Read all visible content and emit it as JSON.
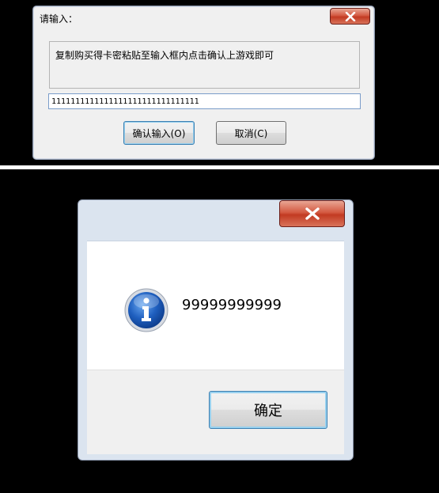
{
  "input_dialog": {
    "title": "请输入：",
    "prompt": "复制购买得卡密粘贴至输入框内点击确认上游戏即可",
    "input_value": "1111111111111111111111111111111",
    "ok_label": "确认输入(O)",
    "cancel_label": "取消(C)"
  },
  "message_dialog": {
    "message": "99999999999",
    "ok_label": "确定",
    "icon": "info-icon"
  },
  "colors": {
    "close_button": "#c94a32",
    "info_icon": "#1f5fbf",
    "focus_border": "#3c7fb1"
  }
}
